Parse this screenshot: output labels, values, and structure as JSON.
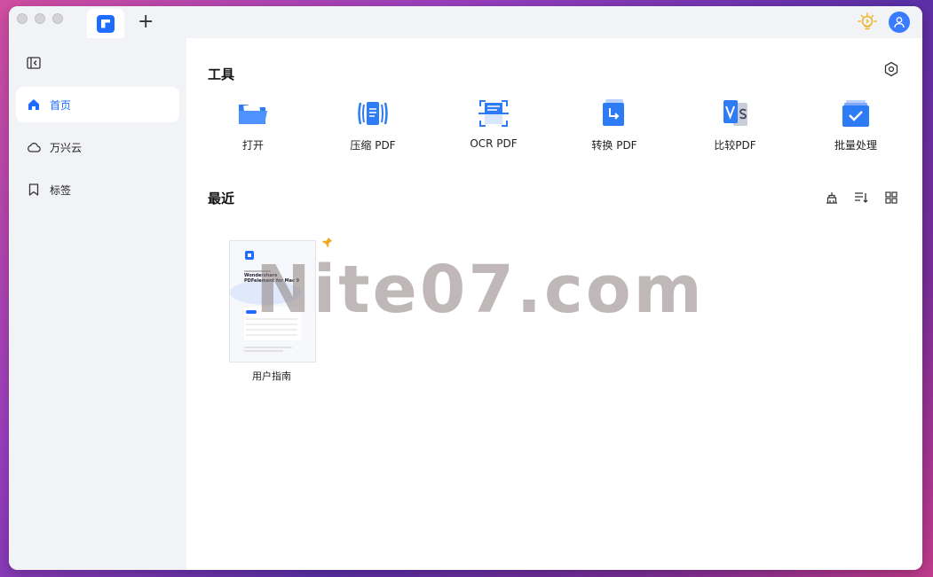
{
  "sidebar": {
    "items": [
      {
        "label": "首页",
        "icon": "home-icon",
        "active": true
      },
      {
        "label": "万兴云",
        "icon": "cloud-icon",
        "active": false
      },
      {
        "label": "标签",
        "icon": "bookmark-icon",
        "active": false
      }
    ]
  },
  "tools": {
    "title": "工具",
    "items": [
      {
        "label": "打开",
        "icon": "open-folder-icon"
      },
      {
        "label": "压缩 PDF",
        "icon": "compress-icon"
      },
      {
        "label": "OCR PDF",
        "icon": "ocr-icon"
      },
      {
        "label": "转换 PDF",
        "icon": "convert-icon"
      },
      {
        "label": "比较PDF",
        "icon": "compare-icon"
      },
      {
        "label": "批量处理",
        "icon": "batch-icon"
      }
    ]
  },
  "recent": {
    "title": "最近",
    "files": [
      {
        "name": "用户指南",
        "pinned": true,
        "thumb_title": "Wondershare PDFelement for Mac 9"
      }
    ]
  },
  "watermark": "Nite07.com",
  "colors": {
    "accent": "#1f6bff",
    "sidebar_bg": "#f2f3f7",
    "pin": "#f5a623"
  }
}
